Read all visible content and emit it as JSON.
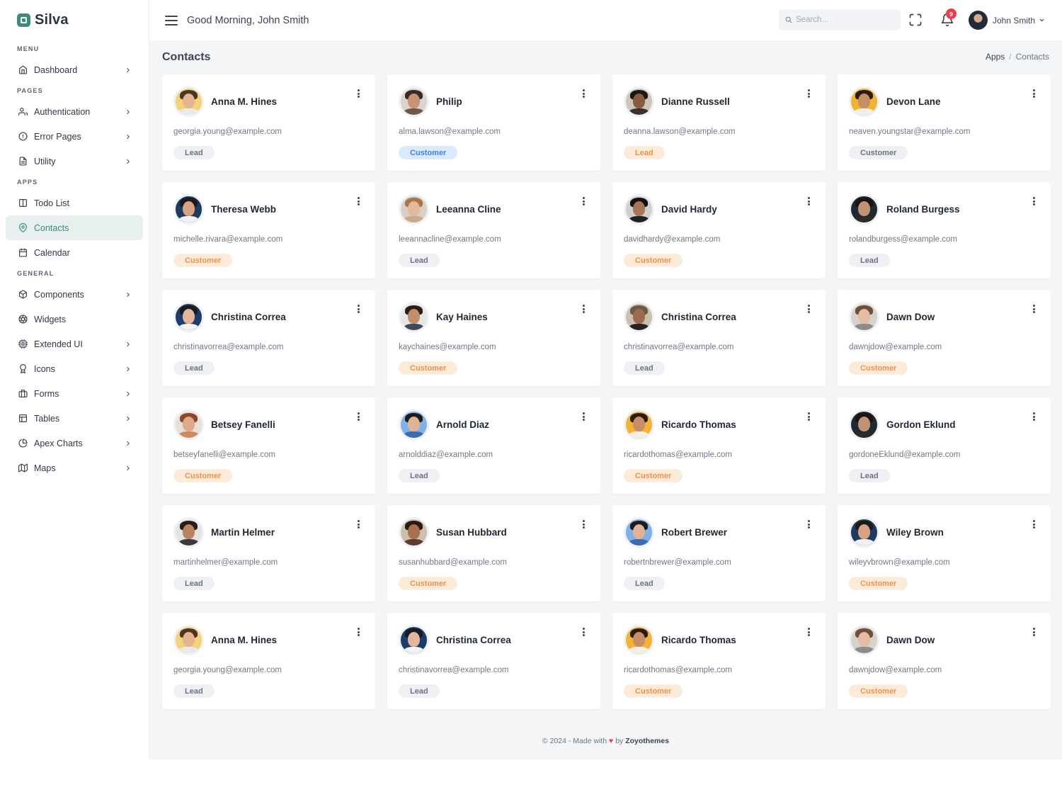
{
  "brand": {
    "name": "Silva"
  },
  "sidebar": {
    "sections": [
      {
        "title": "MENU",
        "items": [
          {
            "label": "Dashboard",
            "icon": "home-icon",
            "chevron": true
          }
        ]
      },
      {
        "title": "PAGES",
        "items": [
          {
            "label": "Authentication",
            "icon": "users-icon",
            "chevron": true
          },
          {
            "label": "Error Pages",
            "icon": "alert-circle-icon",
            "chevron": true
          },
          {
            "label": "Utility",
            "icon": "file-icon",
            "chevron": true
          }
        ]
      },
      {
        "title": "APPS",
        "items": [
          {
            "label": "Todo List",
            "icon": "columns-icon",
            "chevron": false
          },
          {
            "label": "Contacts",
            "icon": "map-pin-icon",
            "chevron": false,
            "active": true
          },
          {
            "label": "Calendar",
            "icon": "calendar-icon",
            "chevron": false
          }
        ]
      },
      {
        "title": "GENERAL",
        "items": [
          {
            "label": "Components",
            "icon": "package-icon",
            "chevron": true
          },
          {
            "label": "Widgets",
            "icon": "aperture-icon",
            "chevron": false
          },
          {
            "label": "Extended UI",
            "icon": "cpu-icon",
            "chevron": true
          },
          {
            "label": "Icons",
            "icon": "award-icon",
            "chevron": true
          },
          {
            "label": "Forms",
            "icon": "briefcase-icon",
            "chevron": true
          },
          {
            "label": "Tables",
            "icon": "table-icon",
            "chevron": true
          },
          {
            "label": "Apex Charts",
            "icon": "pie-chart-icon",
            "chevron": true
          },
          {
            "label": "Maps",
            "icon": "map-icon",
            "chevron": true
          }
        ]
      }
    ]
  },
  "topbar": {
    "greeting": "Good Morning, John Smith",
    "search_placeholder": "Search...",
    "notification_count": "9",
    "user_name": "John Smith"
  },
  "page": {
    "title": "Contacts",
    "breadcrumb": {
      "parent": "Apps",
      "separator": "/",
      "current": "Contacts"
    }
  },
  "colors": {
    "accent": "#3e8a7d",
    "lead_bg": "#eef0f3",
    "customer_orange": "#f0914a",
    "customer_blue": "#3b82f6",
    "notification": "#ef3b4d"
  },
  "contacts": [
    {
      "name": "Anna M. Hines",
      "email": "georgia.young@example.com",
      "tag": "Lead",
      "tag_style": "lead",
      "avatar": {
        "skin": "#e3b48f",
        "hair": "#4a3526",
        "bg": "#f3d27a",
        "shirt": "#e9e9e9"
      }
    },
    {
      "name": "Philip",
      "email": "alma.lawson@example.com",
      "tag": "Customer",
      "tag_style": "customer-blue",
      "avatar": {
        "skin": "#c99274",
        "hair": "#3a2a22",
        "bg": "#d9d4cc",
        "shirt": "#6a5a4d"
      }
    },
    {
      "name": "Dianne Russell",
      "email": "deanna.lawson@example.com",
      "tag": "Lead",
      "tag_style": "customer-orange",
      "avatar": {
        "skin": "#8a5a3e",
        "hair": "#1e1612",
        "bg": "#cfc6bb",
        "shirt": "#3a3230"
      }
    },
    {
      "name": "Devon Lane",
      "email": "neaven.youngstar@example.com",
      "tag": "Customer",
      "tag_style": "customer-gray",
      "avatar": {
        "skin": "#c88d63",
        "hair": "#2a1c14",
        "bg": "#f2b233",
        "shirt": "#f3efe6"
      }
    },
    {
      "name": "Theresa Webb",
      "email": "michelle.rivara@example.com",
      "tag": "Customer",
      "tag_style": "customer-orange",
      "avatar": {
        "skin": "#d6a485",
        "hair": "#1e1a18",
        "bg": "#1d3b5e",
        "shirt": "#f1f1f1"
      }
    },
    {
      "name": "Leeanna Cline",
      "email": "leeannacline@example.com",
      "tag": "Lead",
      "tag_style": "lead",
      "avatar": {
        "skin": "#e6b89b",
        "hair": "#a5764d",
        "bg": "#d9cfc4",
        "shirt": "#c9a98a"
      }
    },
    {
      "name": "David Hardy",
      "email": "davidhardy@example.com",
      "tag": "Customer",
      "tag_style": "customer-orange",
      "avatar": {
        "skin": "#a87657",
        "hair": "#111111",
        "bg": "#d0d0d0",
        "shirt": "#202020"
      }
    },
    {
      "name": "Roland Burgess",
      "email": "rolandburgess@example.com",
      "tag": "Lead",
      "tag_style": "lead",
      "avatar": {
        "skin": "#c29272",
        "hair": "#1a1412",
        "bg": "#202832",
        "shirt": "#2b2b2b"
      }
    },
    {
      "name": "Christina Correa",
      "email": "christinavorrea@example.com",
      "tag": "Lead",
      "tag_style": "lead",
      "avatar": {
        "skin": "#e2b69a",
        "hair": "#1a1a22",
        "bg": "#1c3d6b",
        "shirt": "#f2f2f2"
      }
    },
    {
      "name": "Kay Haines",
      "email": "kaychaines@example.com",
      "tag": "Customer",
      "tag_style": "customer-orange",
      "avatar": {
        "skin": "#c48d6a",
        "hair": "#2b1e17",
        "bg": "#e6e6e6",
        "shirt": "#3d4a5a"
      }
    },
    {
      "name": "Christina Correa",
      "email": "christinavorrea@example.com",
      "tag": "Lead",
      "tag_style": "lead",
      "avatar": {
        "skin": "#9a6b4d",
        "hair": "#6e5a44",
        "bg": "#cbbfb0",
        "shirt": "#2a2220"
      }
    },
    {
      "name": "Dawn Dow",
      "email": "dawnjdow@example.com",
      "tag": "Customer",
      "tag_style": "customer-orange",
      "avatar": {
        "skin": "#e4bca1",
        "hair": "#6f4f39",
        "bg": "#d8d2ca",
        "shirt": "#8b8c8e"
      }
    },
    {
      "name": "Betsey Fanelli",
      "email": "betseyfanelli@example.com",
      "tag": "Customer",
      "tag_style": "customer-orange",
      "avatar": {
        "skin": "#e0a98a",
        "hair": "#8a4a2a",
        "bg": "#e8dfd6",
        "shirt": "#d08a62"
      }
    },
    {
      "name": "Arnold Diaz",
      "email": "arnolddiaz@example.com",
      "tag": "Lead",
      "tag_style": "lead",
      "avatar": {
        "skin": "#e0b394",
        "hair": "#1c1c1c",
        "bg": "#7fb1e8",
        "shirt": "#3a6cb0"
      }
    },
    {
      "name": "Ricardo Thomas",
      "email": "ricardothomas@example.com",
      "tag": "Customer",
      "tag_style": "customer-orange",
      "avatar": {
        "skin": "#c98f64",
        "hair": "#2a1c14",
        "bg": "#f2b233",
        "shirt": "#f3efe6"
      }
    },
    {
      "name": "Gordon Eklund",
      "email": "gordoneEklund@example.com",
      "tag": "Lead",
      "tag_style": "lead",
      "avatar": {
        "skin": "#c29272",
        "hair": "#1a1412",
        "bg": "#202832",
        "shirt": "#2b2b2b"
      }
    },
    {
      "name": "Martin Helmer",
      "email": "martinhelmer@example.com",
      "tag": "Lead",
      "tag_style": "lead",
      "avatar": {
        "skin": "#b98364",
        "hair": "#2a1e18",
        "bg": "#e3e3e3",
        "shirt": "#3a3a3a"
      }
    },
    {
      "name": "Susan Hubbard",
      "email": "susanhubbard@example.com",
      "tag": "Customer",
      "tag_style": "customer-orange",
      "avatar": {
        "skin": "#a86f50",
        "hair": "#2a1a12",
        "bg": "#cbbfb0",
        "shirt": "#5c3d2e"
      }
    },
    {
      "name": "Robert Brewer",
      "email": "robertnbrewer@example.com",
      "tag": "Lead",
      "tag_style": "lead",
      "avatar": {
        "skin": "#e0b394",
        "hair": "#1c1c1c",
        "bg": "#7fb1e8",
        "shirt": "#3a6cb0"
      }
    },
    {
      "name": "Wiley Brown",
      "email": "wileyvbrown@example.com",
      "tag": "Customer",
      "tag_style": "customer-orange",
      "avatar": {
        "skin": "#d6a485",
        "hair": "#1e1a18",
        "bg": "#1d3b5e",
        "shirt": "#f1f1f1"
      }
    },
    {
      "name": "Anna M. Hines",
      "email": "georgia.young@example.com",
      "tag": "Lead",
      "tag_style": "lead",
      "avatar": {
        "skin": "#e3b48f",
        "hair": "#4a3526",
        "bg": "#f3d27a",
        "shirt": "#e9e9e9"
      }
    },
    {
      "name": "Christina Correa",
      "email": "christinavorrea@example.com",
      "tag": "Lead",
      "tag_style": "lead",
      "avatar": {
        "skin": "#e2b69a",
        "hair": "#1a1a22",
        "bg": "#1c3d6b",
        "shirt": "#f2f2f2"
      }
    },
    {
      "name": "Ricardo Thomas",
      "email": "ricardothomas@example.com",
      "tag": "Customer",
      "tag_style": "customer-orange",
      "avatar": {
        "skin": "#c98f64",
        "hair": "#2a1c14",
        "bg": "#f2b233",
        "shirt": "#f3efe6"
      }
    },
    {
      "name": "Dawn Dow",
      "email": "dawnjdow@example.com",
      "tag": "Customer",
      "tag_style": "customer-orange",
      "avatar": {
        "skin": "#e4bca1",
        "hair": "#6f4f39",
        "bg": "#d8d2ca",
        "shirt": "#8b8c8e"
      }
    }
  ],
  "footer": {
    "prefix": "© 2024 - Made with",
    "heart": "♥",
    "by": "by",
    "brand": "Zoyothemes"
  }
}
